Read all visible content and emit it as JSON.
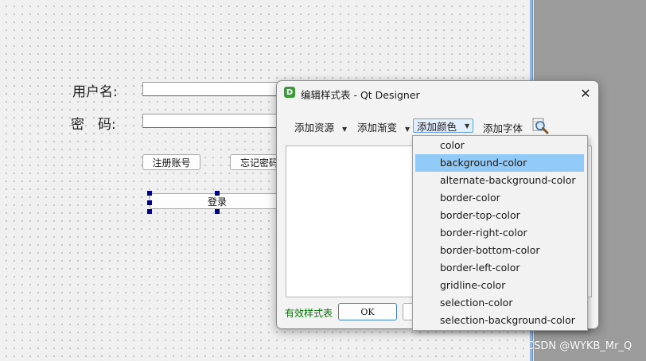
{
  "form": {
    "username_label": "用户名:",
    "password_label": "密　码:",
    "register_button": "注册账号",
    "forgot_button": "忘记密码",
    "login_button": "登录"
  },
  "dialog": {
    "app_icon_letter": "D",
    "title": "编辑样式表 - Qt Designer",
    "close_symbol": "✕",
    "toolbar": {
      "add_resource": "添加资源",
      "add_gradient": "添加渐变",
      "add_color": "添加颜色",
      "add_font": "添加字体",
      "find_icon": "magnifier-icon"
    },
    "valid_status": "有效样式表",
    "ok_button": "OK"
  },
  "color_menu": {
    "items": [
      {
        "label": "color"
      },
      {
        "label": "background-color",
        "selected": true
      },
      {
        "label": "alternate-background-color"
      },
      {
        "label": "border-color"
      },
      {
        "label": "border-top-color"
      },
      {
        "label": "border-right-color"
      },
      {
        "label": "border-bottom-color"
      },
      {
        "label": "border-left-color"
      },
      {
        "label": "gridline-color"
      },
      {
        "label": "selection-color"
      },
      {
        "label": "selection-background-color"
      }
    ]
  },
  "watermark": "CSDN @WYKB_Mr_Q",
  "colors": {
    "selection_handle": "#00007f",
    "menu_highlight": "#91c9f7",
    "valid_text": "#007a00",
    "app_icon": "#3a9b3a"
  }
}
